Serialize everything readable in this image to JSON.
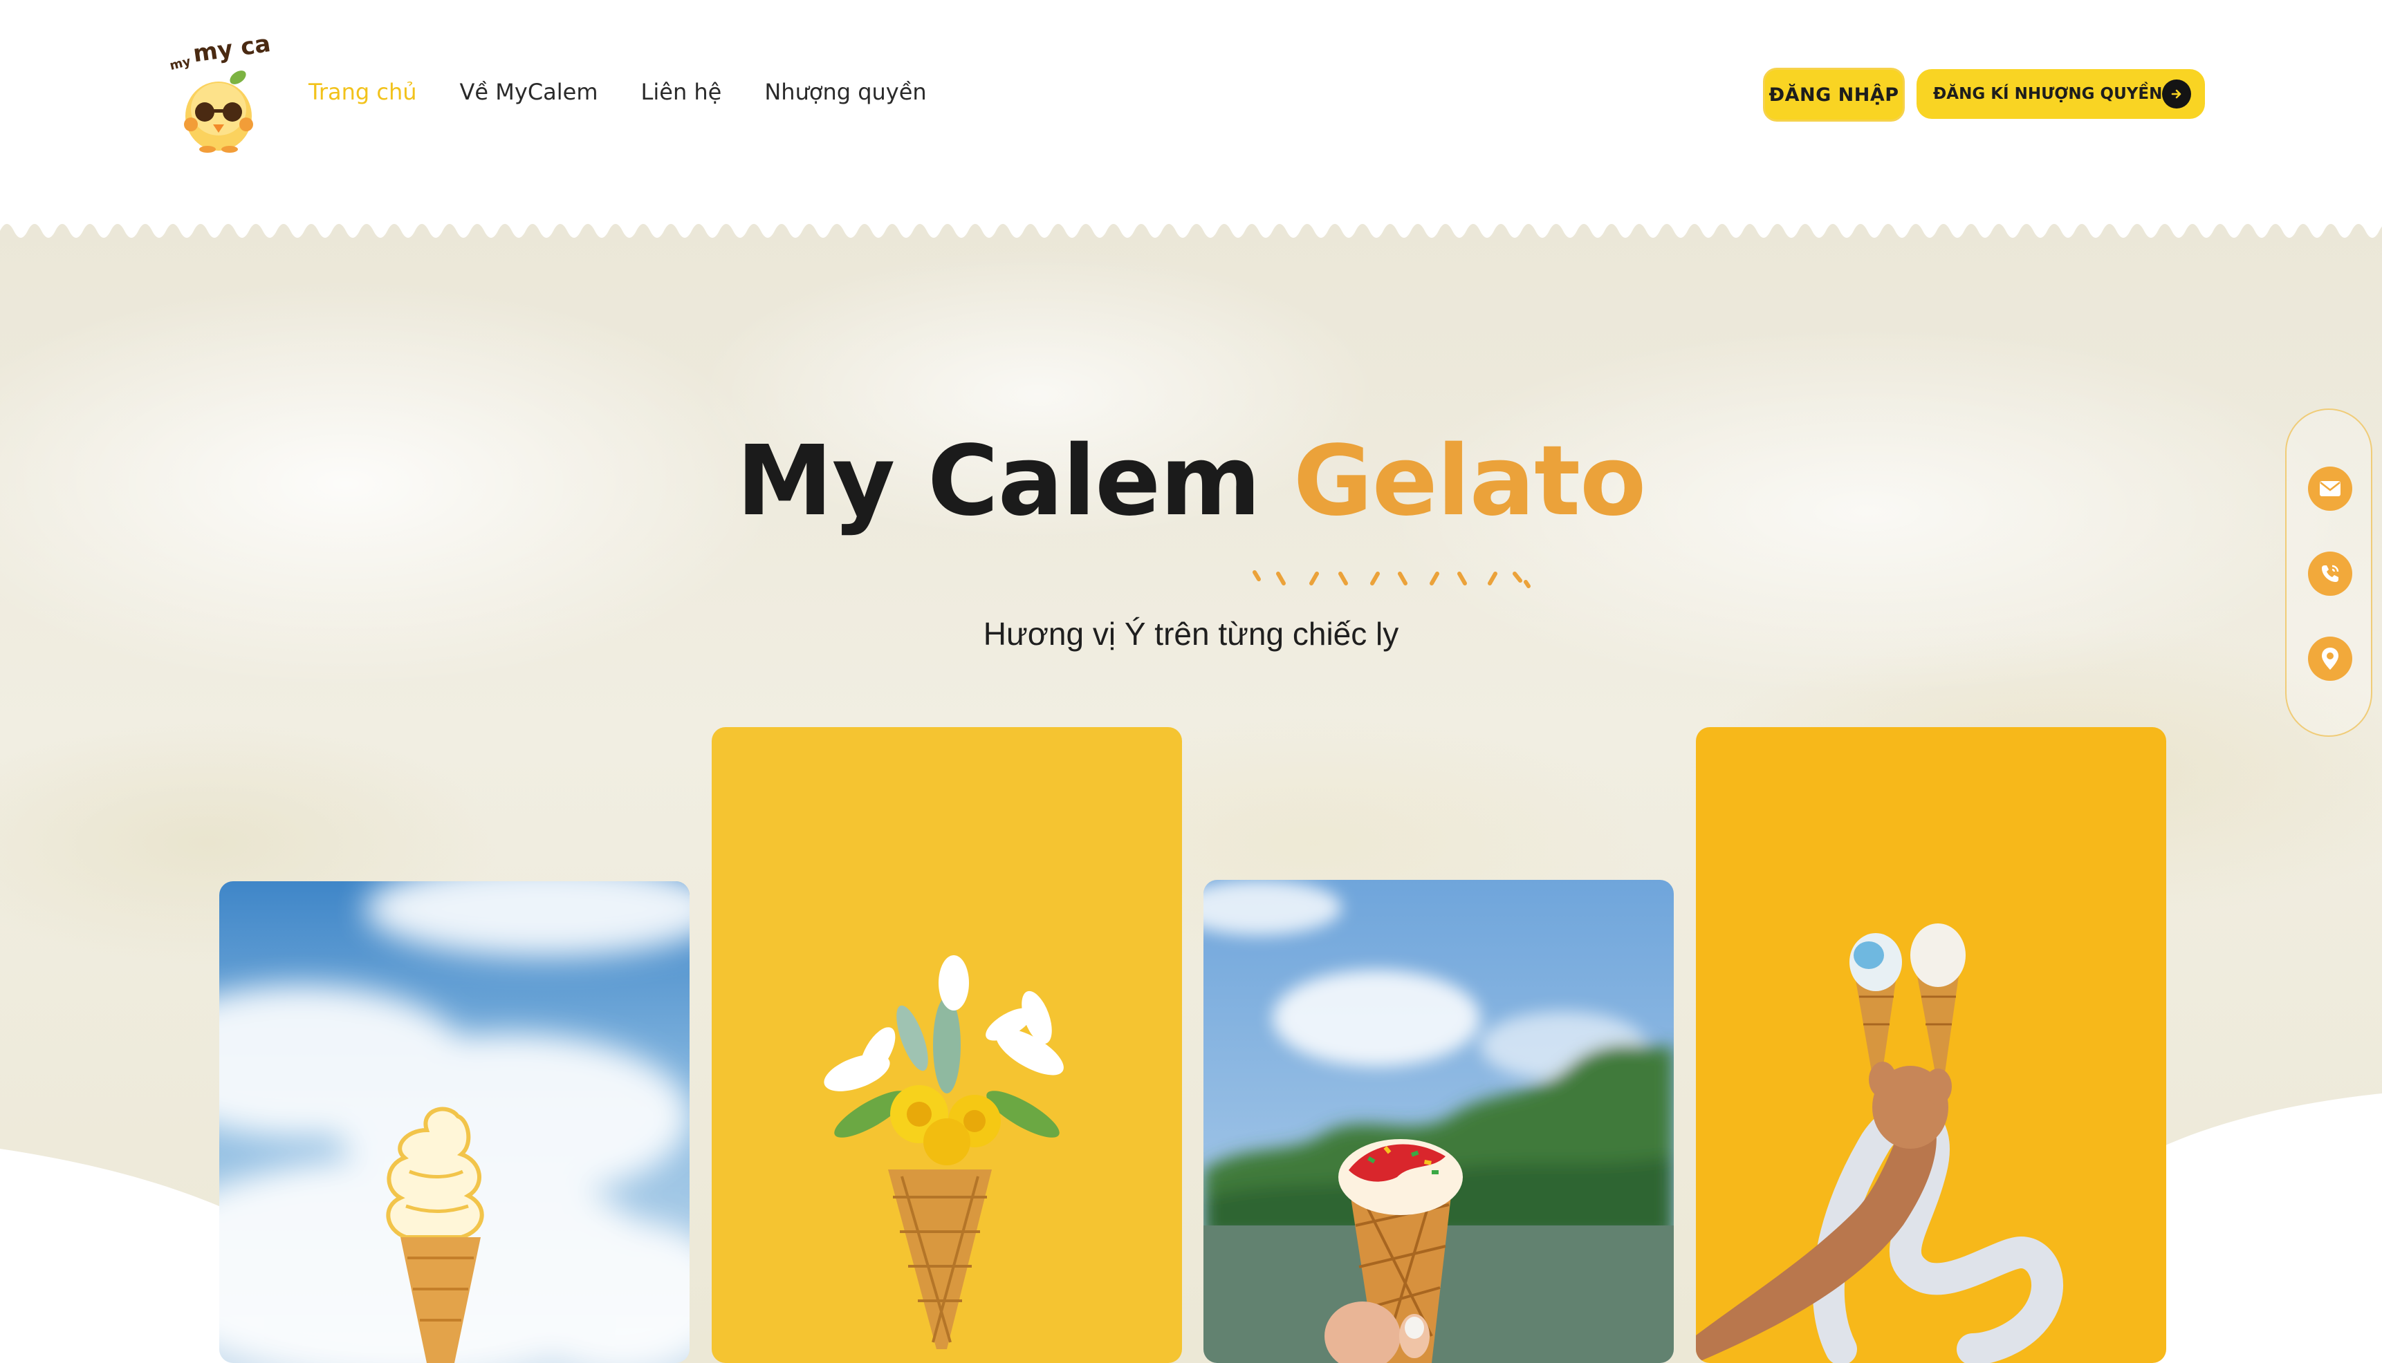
{
  "header": {
    "logo_text": "my calem",
    "nav": [
      {
        "label": "Trang chủ",
        "active": true
      },
      {
        "label": "Về MyCalem",
        "active": false
      },
      {
        "label": "Liên hệ",
        "active": false
      },
      {
        "label": "Nhượng quyền",
        "active": false
      }
    ],
    "login_label": "ĐĂNG NHẬP",
    "franchise_label": "ĐĂNG KÍ NHƯỢNG QUYỀN"
  },
  "hero": {
    "title_main": "My Calem",
    "title_accent": "Gelato",
    "subtitle": "Hương vị Ý trên từng chiếc ly"
  },
  "contact_rail": [
    {
      "icon": "mail-icon"
    },
    {
      "icon": "phone-icon"
    },
    {
      "icon": "location-pin-icon"
    }
  ],
  "cards": [
    {
      "icon": "soft-serve-cone-sky-image"
    },
    {
      "icon": "flower-bouquet-cone-image"
    },
    {
      "icon": "sprinkle-cone-lake-image"
    },
    {
      "icon": "two-cones-hand-image"
    }
  ],
  "colors": {
    "brand_yellow": "#f9d423",
    "accent_orange": "#eba23a",
    "nav_active": "#f2c21b",
    "text_dark": "#1b1b1b"
  }
}
